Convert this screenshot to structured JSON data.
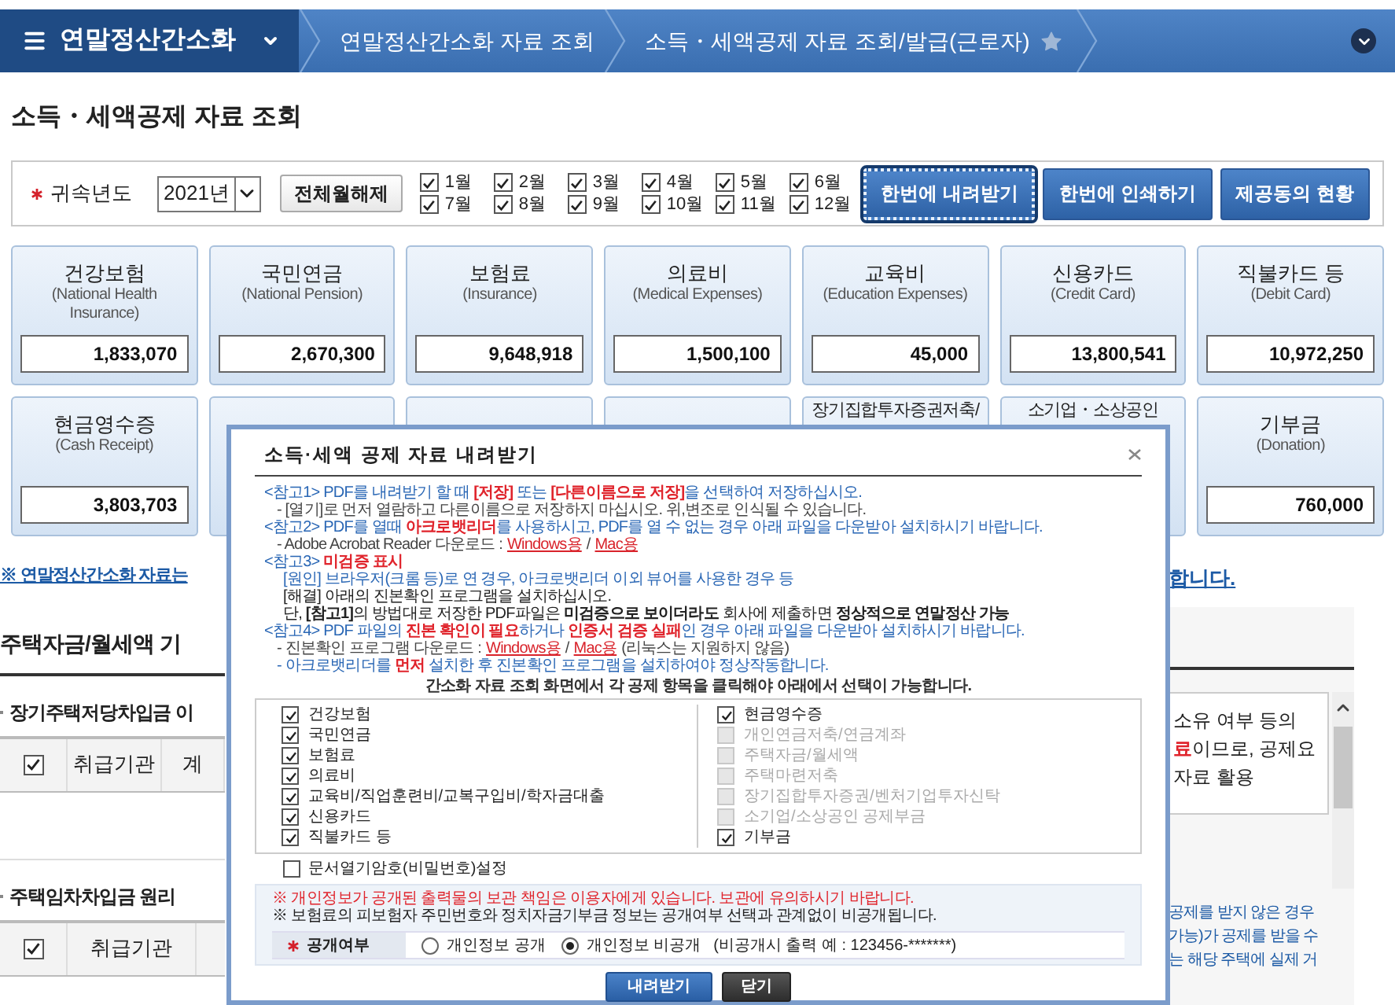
{
  "breadcrumb": {
    "home": "연말정산간소화",
    "items": [
      "연말정산간소화 자료 조회",
      "소득・세액공제 자료 조회/발급(근로자)"
    ],
    "favorite": false
  },
  "page_title": "소득・세액공제 자료 조회",
  "filter": {
    "year_label": "귀속년도",
    "required": true,
    "year": "2021년",
    "clear_button": "전체월해제",
    "months": [
      {
        "label": "1월",
        "checked": true
      },
      {
        "label": "2월",
        "checked": true
      },
      {
        "label": "3월",
        "checked": true
      },
      {
        "label": "4월",
        "checked": true
      },
      {
        "label": "5월",
        "checked": true
      },
      {
        "label": "6월",
        "checked": true
      },
      {
        "label": "7월",
        "checked": true
      },
      {
        "label": "8월",
        "checked": true
      },
      {
        "label": "9월",
        "checked": true
      },
      {
        "label": "10월",
        "checked": true
      },
      {
        "label": "11월",
        "checked": true
      },
      {
        "label": "12월",
        "checked": true
      }
    ],
    "buttons": [
      {
        "label": "한번에 내려받기",
        "focused": true
      },
      {
        "label": "한번에 인쇄하기",
        "focused": false
      },
      {
        "label": "제공동의 현황",
        "focused": false
      }
    ]
  },
  "cards": [
    {
      "kind": "full",
      "title": "건강보험",
      "subtitle": "(National Health Insurance)",
      "value": "1,833,070"
    },
    {
      "kind": "full",
      "title": "국민연금",
      "subtitle": "(National Pension)",
      "value": "2,670,300"
    },
    {
      "kind": "full",
      "title": "보험료",
      "subtitle": "(Insurance)",
      "value": "9,648,918"
    },
    {
      "kind": "full",
      "title": "의료비",
      "subtitle": "(Medical Expenses)",
      "value": "1,500,100"
    },
    {
      "kind": "full",
      "title": "교육비",
      "subtitle": "(Education Expenses)",
      "value": "45,000"
    },
    {
      "kind": "full",
      "title": "신용카드",
      "subtitle": "(Credit Card)",
      "value": "13,800,541"
    },
    {
      "kind": "full",
      "title": "직불카드 등",
      "subtitle": "(Debit Card)",
      "value": "10,972,250"
    },
    {
      "kind": "full",
      "title": "현금영수증",
      "subtitle": "(Cash Receipt)",
      "value": "3,803,703"
    },
    {
      "kind": "covered"
    },
    {
      "kind": "covered"
    },
    {
      "kind": "covered"
    },
    {
      "kind": "partial",
      "title": "장기집합투자증권저축/"
    },
    {
      "kind": "partial",
      "title": "소기업・소상공인"
    },
    {
      "kind": "full",
      "title": "기부금",
      "subtitle": "(Donation)",
      "value": "760,000"
    }
  ],
  "notice_link": {
    "start": "※ 연말정산간소화 자료는",
    "end": "합니다."
  },
  "section_title": "주택자금/월세액 기",
  "subsections": [
    {
      "title": "장기주택저당차입금 이",
      "select_all": true,
      "columns": [
        "취급기관",
        "계"
      ]
    },
    {
      "title": "주택임차차입금 원리",
      "select_all": true,
      "columns": [
        "취급기관"
      ]
    }
  ],
  "info_box": {
    "lines": [
      "소유 여부 등의",
      "**료**이므로, 공제요",
      "자료 활용"
    ]
  },
  "note_lines": [
    "공제를 받지 않은 경우",
    "가능)가 공제를 받을 수",
    "는 해당 주택에 실제 거"
  ],
  "modal": {
    "title": "소득·세액 공제 자료 내려받기",
    "notes": [
      {
        "kind": "heading",
        "parts": [
          {
            "kind": "text",
            "text": "<참고1> PDF를 내려받기 할 때 **[저장]** 또는 **[다른이름으로 저장]**을 선택하여 저장하십시오."
          }
        ]
      },
      {
        "kind": "sub",
        "parts": [
          {
            "kind": "text",
            "text": "- [열기]로 먼저 열람하고 다른이름으로 저장하지 마십시오. 위,변조로 인식될 수 있습니다."
          }
        ]
      },
      {
        "kind": "heading",
        "parts": [
          {
            "kind": "text",
            "text": "<참고2> PDF를 열때 **아크로뱃리더**를 사용하시고, PDF를 열 수 없는 경우 아래 파일을 다운받아 설치하시기 바랍니다."
          }
        ]
      },
      {
        "kind": "sub",
        "parts": [
          {
            "kind": "text",
            "text": "- Adobe Acrobat Reader 다운로드 :"
          },
          {
            "kind": "link",
            "text": "Windows용"
          },
          {
            "kind": "text",
            "text": "/"
          },
          {
            "kind": "link",
            "text": "Mac용"
          }
        ]
      },
      {
        "kind": "heading",
        "parts": [
          {
            "kind": "text",
            "text": "<참고3> **미검증 표시**"
          }
        ]
      },
      {
        "kind": "accent",
        "parts": [
          {
            "kind": "text",
            "text": "[원인] 브라우저(크롬 등)로 연 경우, 아크로뱃리더 이외 뷰어를 사용한 경우 등"
          }
        ]
      },
      {
        "kind": "plain",
        "parts": [
          {
            "kind": "text",
            "text": "[해결] 아래의 진본확인 프로그램을 설치하십시오."
          }
        ]
      },
      {
        "kind": "plain",
        "parts": [
          {
            "kind": "text",
            "text": "단, **[참고1]**의 방법대로 저장한 PDF파일은 **미검증으로 보이더라도** 회사에 제출하면 **정상적으로 연말정산 가능**"
          }
        ]
      },
      {
        "kind": "heading",
        "parts": [
          {
            "kind": "text",
            "text": "<참고4> PDF 파일의 **진본 확인이 필요**하거나 **인증서 검증 실패**인 경우 아래 파일을 다운받아 설치하시기 바랍니다."
          }
        ]
      },
      {
        "kind": "sub",
        "parts": [
          {
            "kind": "text",
            "text": "- 진본확인 프로그램 다운로드 :"
          },
          {
            "kind": "link",
            "text": "Windows용"
          },
          {
            "kind": "text",
            "text": "/"
          },
          {
            "kind": "link",
            "text": "Mac용"
          },
          {
            "kind": "text",
            "text": "(리눅스는 지원하지 않음)"
          }
        ]
      },
      {
        "kind": "sub_accent",
        "parts": [
          {
            "kind": "text",
            "text": "- 아크로뱃리더를 **먼저** 설치한 후 진본확인 프로그램을 설치하여야 정상작동합니다."
          }
        ]
      }
    ],
    "caption": "간소화 자료 조회 화면에서 각 공제 항목을 클릭해야 아래에서 선택이 가능합니다.",
    "left_items": [
      {
        "label": "건강보험",
        "checked": true,
        "disabled": false
      },
      {
        "label": "국민연금",
        "checked": true,
        "disabled": false
      },
      {
        "label": "보험료",
        "checked": true,
        "disabled": false
      },
      {
        "label": "의료비",
        "checked": true,
        "disabled": false
      },
      {
        "label": "교육비/직업훈련비/교복구입비/학자금대출",
        "checked": true,
        "disabled": false
      },
      {
        "label": "신용카드",
        "checked": true,
        "disabled": false
      },
      {
        "label": "직불카드 등",
        "checked": true,
        "disabled": false
      }
    ],
    "right_items": [
      {
        "label": "현금영수증",
        "checked": true,
        "disabled": false
      },
      {
        "label": "개인연금저축/연금계좌",
        "checked": false,
        "disabled": true
      },
      {
        "label": "주택자금/월세액",
        "checked": false,
        "disabled": true
      },
      {
        "label": "주택마련저축",
        "checked": false,
        "disabled": true
      },
      {
        "label": "장기집합투자증권/벤처기업투자신탁",
        "checked": false,
        "disabled": true
      },
      {
        "label": "소기업/소상공인 공제부금",
        "checked": false,
        "disabled": true
      },
      {
        "label": "기부금",
        "checked": true,
        "disabled": false
      }
    ],
    "password_option": {
      "label": "문서열기암호(비밀번호)설정",
      "checked": false
    },
    "warnings": [
      {
        "kind": "alert",
        "text": "※ 개인정보가 공개된 출력물의 보관 책임은 이용자에게 있습니다. 보관에 유의하시기 바랍니다."
      },
      {
        "kind": "info",
        "text": "※ 보험료의 피보험자 주민번호와 정치자금기부금 정보는 공개여부 선택과 관계없이 비공개됩니다."
      }
    ],
    "disclosure": {
      "label": "공개여부",
      "required": true,
      "options": [
        {
          "label": "개인정보 공개",
          "selected": false
        },
        {
          "label": "개인정보 비공개",
          "selected": true
        }
      ],
      "hint": "(비공개시 출력 예 : 123456-*******)"
    },
    "buttons": [
      {
        "kind": "primary",
        "label": "내려받기"
      },
      {
        "kind": "secondary",
        "label": "닫기"
      }
    ]
  }
}
